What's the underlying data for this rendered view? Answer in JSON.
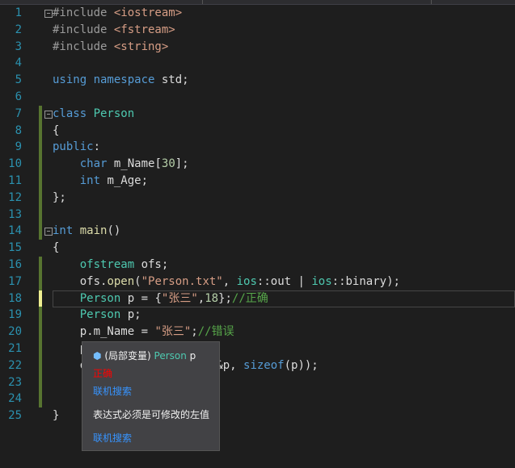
{
  "lines": [
    {
      "n": "1",
      "t": [
        [
          "pp",
          "#include "
        ],
        [
          "inc",
          "<iostream>"
        ]
      ]
    },
    {
      "n": "2",
      "t": [
        [
          "pp",
          "#include "
        ],
        [
          "inc",
          "<fstream>"
        ]
      ]
    },
    {
      "n": "3",
      "t": [
        [
          "pp",
          "#include "
        ],
        [
          "inc",
          "<string>"
        ]
      ]
    },
    {
      "n": "4",
      "t": []
    },
    {
      "n": "5",
      "t": [
        [
          "kw",
          "using namespace "
        ],
        [
          "",
          "std;"
        ]
      ]
    },
    {
      "n": "6",
      "t": []
    },
    {
      "n": "7",
      "t": [
        [
          "kw",
          "class "
        ],
        [
          "ty",
          "Person"
        ]
      ]
    },
    {
      "n": "8",
      "t": [
        [
          "",
          "{"
        ]
      ]
    },
    {
      "n": "9",
      "t": [
        [
          "kw",
          "public"
        ],
        [
          "",
          ":"
        ]
      ]
    },
    {
      "n": "10",
      "t": [
        [
          "",
          "    "
        ],
        [
          "kw",
          "char "
        ],
        [
          "",
          "m_Name["
        ],
        [
          "num",
          "30"
        ],
        [
          "",
          "];"
        ]
      ]
    },
    {
      "n": "11",
      "t": [
        [
          "",
          "    "
        ],
        [
          "kw",
          "int "
        ],
        [
          "",
          "m_Age;"
        ]
      ]
    },
    {
      "n": "12",
      "t": [
        [
          "",
          "};"
        ]
      ]
    },
    {
      "n": "13",
      "t": []
    },
    {
      "n": "14",
      "t": [
        [
          "kw",
          "int "
        ],
        [
          "fn",
          "main"
        ],
        [
          "",
          "()"
        ]
      ]
    },
    {
      "n": "15",
      "t": [
        [
          "",
          "{"
        ]
      ]
    },
    {
      "n": "16",
      "t": [
        [
          "",
          "    "
        ],
        [
          "ty",
          "ofstream "
        ],
        [
          "",
          "ofs;"
        ]
      ]
    },
    {
      "n": "17",
      "t": [
        [
          "",
          "    ofs."
        ],
        [
          "fn",
          "open"
        ],
        [
          "",
          "("
        ],
        [
          "str",
          "\"Person.txt\""
        ],
        [
          "",
          ", "
        ],
        [
          "ty",
          "ios"
        ],
        [
          "",
          "::"
        ],
        [
          "",
          "out | "
        ],
        [
          "ty",
          "ios"
        ],
        [
          "",
          "::binary);"
        ]
      ]
    },
    {
      "n": "18",
      "t": [
        [
          "",
          "    "
        ],
        [
          "ty",
          "Person "
        ],
        [
          "",
          "p = {"
        ],
        [
          "str",
          "\"张三\""
        ],
        [
          "",
          ","
        ],
        [
          "num",
          "18"
        ],
        [
          "",
          "};"
        ],
        [
          "cm",
          "//正确"
        ]
      ]
    },
    {
      "n": "19",
      "t": [
        [
          "",
          "    "
        ],
        [
          "ty",
          "Person "
        ],
        [
          "",
          "p;"
        ]
      ]
    },
    {
      "n": "20",
      "t": [
        [
          "",
          "    p.m_Name = "
        ],
        [
          "str",
          "\"张三\""
        ],
        [
          "",
          ";"
        ],
        [
          "cm",
          "//错误"
        ]
      ]
    },
    {
      "n": "21",
      "t": [
        [
          "",
          "    p"
        ]
      ]
    },
    {
      "n": "22",
      "t": [
        [
          "",
          "    o                 *)&p, "
        ],
        [
          "kw",
          "sizeof"
        ],
        [
          "",
          "(p));"
        ]
      ]
    },
    {
      "n": "23",
      "t": []
    },
    {
      "n": "24",
      "t": [
        [
          "",
          "    "
        ]
      ]
    },
    {
      "n": "25",
      "t": [
        [
          "",
          "}"
        ]
      ]
    }
  ],
  "tooltip": {
    "icon": "local-variable-icon",
    "prefix": "(局部变量)",
    "type": "Person",
    "name": "p",
    "comment": "正确",
    "search1": "联机搜索",
    "error": "表达式必须是可修改的左值",
    "search2": "联机搜索",
    "comment_color": "#ff0000",
    "link_color": "#3794ff"
  },
  "colors": {
    "bar_saved": "#577430",
    "bar_unsaved": "#efef91"
  }
}
